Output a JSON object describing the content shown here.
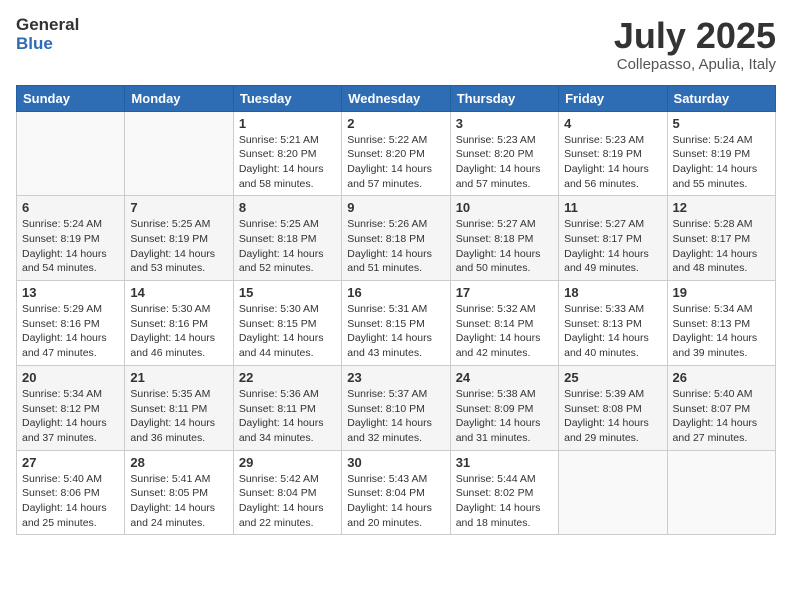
{
  "header": {
    "logo_general": "General",
    "logo_blue": "Blue",
    "month_title": "July 2025",
    "location": "Collepasso, Apulia, Italy"
  },
  "days_of_week": [
    "Sunday",
    "Monday",
    "Tuesday",
    "Wednesday",
    "Thursday",
    "Friday",
    "Saturday"
  ],
  "weeks": [
    [
      {
        "day": "",
        "empty": true
      },
      {
        "day": "",
        "empty": true
      },
      {
        "day": "1",
        "sunrise": "Sunrise: 5:21 AM",
        "sunset": "Sunset: 8:20 PM",
        "daylight": "Daylight: 14 hours and 58 minutes."
      },
      {
        "day": "2",
        "sunrise": "Sunrise: 5:22 AM",
        "sunset": "Sunset: 8:20 PM",
        "daylight": "Daylight: 14 hours and 57 minutes."
      },
      {
        "day": "3",
        "sunrise": "Sunrise: 5:23 AM",
        "sunset": "Sunset: 8:20 PM",
        "daylight": "Daylight: 14 hours and 57 minutes."
      },
      {
        "day": "4",
        "sunrise": "Sunrise: 5:23 AM",
        "sunset": "Sunset: 8:19 PM",
        "daylight": "Daylight: 14 hours and 56 minutes."
      },
      {
        "day": "5",
        "sunrise": "Sunrise: 5:24 AM",
        "sunset": "Sunset: 8:19 PM",
        "daylight": "Daylight: 14 hours and 55 minutes."
      }
    ],
    [
      {
        "day": "6",
        "sunrise": "Sunrise: 5:24 AM",
        "sunset": "Sunset: 8:19 PM",
        "daylight": "Daylight: 14 hours and 54 minutes."
      },
      {
        "day": "7",
        "sunrise": "Sunrise: 5:25 AM",
        "sunset": "Sunset: 8:19 PM",
        "daylight": "Daylight: 14 hours and 53 minutes."
      },
      {
        "day": "8",
        "sunrise": "Sunrise: 5:25 AM",
        "sunset": "Sunset: 8:18 PM",
        "daylight": "Daylight: 14 hours and 52 minutes."
      },
      {
        "day": "9",
        "sunrise": "Sunrise: 5:26 AM",
        "sunset": "Sunset: 8:18 PM",
        "daylight": "Daylight: 14 hours and 51 minutes."
      },
      {
        "day": "10",
        "sunrise": "Sunrise: 5:27 AM",
        "sunset": "Sunset: 8:18 PM",
        "daylight": "Daylight: 14 hours and 50 minutes."
      },
      {
        "day": "11",
        "sunrise": "Sunrise: 5:27 AM",
        "sunset": "Sunset: 8:17 PM",
        "daylight": "Daylight: 14 hours and 49 minutes."
      },
      {
        "day": "12",
        "sunrise": "Sunrise: 5:28 AM",
        "sunset": "Sunset: 8:17 PM",
        "daylight": "Daylight: 14 hours and 48 minutes."
      }
    ],
    [
      {
        "day": "13",
        "sunrise": "Sunrise: 5:29 AM",
        "sunset": "Sunset: 8:16 PM",
        "daylight": "Daylight: 14 hours and 47 minutes."
      },
      {
        "day": "14",
        "sunrise": "Sunrise: 5:30 AM",
        "sunset": "Sunset: 8:16 PM",
        "daylight": "Daylight: 14 hours and 46 minutes."
      },
      {
        "day": "15",
        "sunrise": "Sunrise: 5:30 AM",
        "sunset": "Sunset: 8:15 PM",
        "daylight": "Daylight: 14 hours and 44 minutes."
      },
      {
        "day": "16",
        "sunrise": "Sunrise: 5:31 AM",
        "sunset": "Sunset: 8:15 PM",
        "daylight": "Daylight: 14 hours and 43 minutes."
      },
      {
        "day": "17",
        "sunrise": "Sunrise: 5:32 AM",
        "sunset": "Sunset: 8:14 PM",
        "daylight": "Daylight: 14 hours and 42 minutes."
      },
      {
        "day": "18",
        "sunrise": "Sunrise: 5:33 AM",
        "sunset": "Sunset: 8:13 PM",
        "daylight": "Daylight: 14 hours and 40 minutes."
      },
      {
        "day": "19",
        "sunrise": "Sunrise: 5:34 AM",
        "sunset": "Sunset: 8:13 PM",
        "daylight": "Daylight: 14 hours and 39 minutes."
      }
    ],
    [
      {
        "day": "20",
        "sunrise": "Sunrise: 5:34 AM",
        "sunset": "Sunset: 8:12 PM",
        "daylight": "Daylight: 14 hours and 37 minutes."
      },
      {
        "day": "21",
        "sunrise": "Sunrise: 5:35 AM",
        "sunset": "Sunset: 8:11 PM",
        "daylight": "Daylight: 14 hours and 36 minutes."
      },
      {
        "day": "22",
        "sunrise": "Sunrise: 5:36 AM",
        "sunset": "Sunset: 8:11 PM",
        "daylight": "Daylight: 14 hours and 34 minutes."
      },
      {
        "day": "23",
        "sunrise": "Sunrise: 5:37 AM",
        "sunset": "Sunset: 8:10 PM",
        "daylight": "Daylight: 14 hours and 32 minutes."
      },
      {
        "day": "24",
        "sunrise": "Sunrise: 5:38 AM",
        "sunset": "Sunset: 8:09 PM",
        "daylight": "Daylight: 14 hours and 31 minutes."
      },
      {
        "day": "25",
        "sunrise": "Sunrise: 5:39 AM",
        "sunset": "Sunset: 8:08 PM",
        "daylight": "Daylight: 14 hours and 29 minutes."
      },
      {
        "day": "26",
        "sunrise": "Sunrise: 5:40 AM",
        "sunset": "Sunset: 8:07 PM",
        "daylight": "Daylight: 14 hours and 27 minutes."
      }
    ],
    [
      {
        "day": "27",
        "sunrise": "Sunrise: 5:40 AM",
        "sunset": "Sunset: 8:06 PM",
        "daylight": "Daylight: 14 hours and 25 minutes."
      },
      {
        "day": "28",
        "sunrise": "Sunrise: 5:41 AM",
        "sunset": "Sunset: 8:05 PM",
        "daylight": "Daylight: 14 hours and 24 minutes."
      },
      {
        "day": "29",
        "sunrise": "Sunrise: 5:42 AM",
        "sunset": "Sunset: 8:04 PM",
        "daylight": "Daylight: 14 hours and 22 minutes."
      },
      {
        "day": "30",
        "sunrise": "Sunrise: 5:43 AM",
        "sunset": "Sunset: 8:04 PM",
        "daylight": "Daylight: 14 hours and 20 minutes."
      },
      {
        "day": "31",
        "sunrise": "Sunrise: 5:44 AM",
        "sunset": "Sunset: 8:02 PM",
        "daylight": "Daylight: 14 hours and 18 minutes."
      },
      {
        "day": "",
        "empty": true
      },
      {
        "day": "",
        "empty": true
      }
    ]
  ]
}
